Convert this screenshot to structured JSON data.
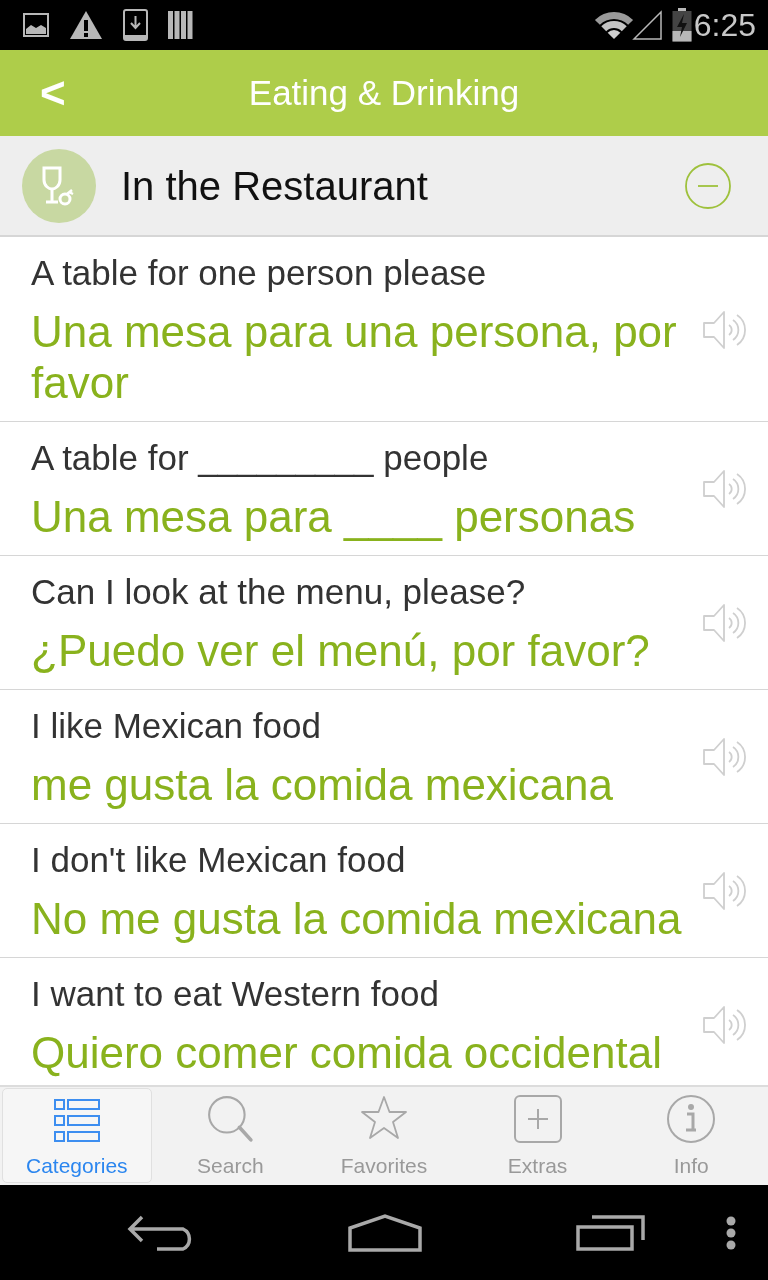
{
  "status_bar": {
    "time": "6:25"
  },
  "header": {
    "back_label": "<",
    "title": "Eating & Drinking"
  },
  "category": {
    "title": "In the Restaurant",
    "expanded": true
  },
  "phrases": [
    {
      "english": "A table for one person please",
      "spanish": "Una mesa para una persona, por favor"
    },
    {
      "english": "A table for _________ people",
      "spanish": "Una mesa para ____ personas"
    },
    {
      "english": "Can I look at the menu, please?",
      "spanish": "¿Puedo ver el menú, por favor?"
    },
    {
      "english": "I like Mexican food",
      "spanish": "me gusta la comida mexicana"
    },
    {
      "english": "I don't like Mexican food",
      "spanish": "No me gusta la comida mexicana"
    },
    {
      "english": "I want to eat Western food",
      "spanish": "Quiero comer comida occidental"
    }
  ],
  "tab_bar": {
    "tabs": [
      {
        "label": "Categories",
        "selected": true
      },
      {
        "label": "Search",
        "selected": false
      },
      {
        "label": "Favorites",
        "selected": false
      },
      {
        "label": "Extras",
        "selected": false
      },
      {
        "label": "Info",
        "selected": false
      }
    ]
  }
}
